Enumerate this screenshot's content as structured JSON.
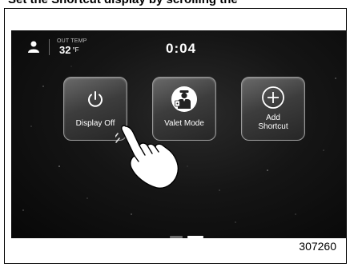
{
  "caption": "Set the Shortcut display by scrolling the",
  "status": {
    "temp_label": "OUT TEMP",
    "temp_value": "32",
    "temp_unit": "°F",
    "time": "0:04"
  },
  "tiles": [
    {
      "label": "Display Off",
      "icon": "power-icon"
    },
    {
      "label": "Valet Mode",
      "icon": "valet-icon"
    },
    {
      "label": "Add\nShortcut",
      "icon": "add-icon"
    }
  ],
  "pagination": {
    "pages": 2,
    "active_page": 2
  },
  "figure_number": "307260"
}
